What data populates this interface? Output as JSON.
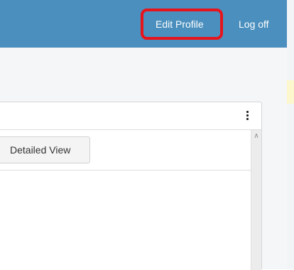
{
  "header": {
    "edit_profile_label": "Edit Profile",
    "log_off_label": "Log off",
    "background_color": "#4a8fbe",
    "highlight_color": "#e8141c"
  },
  "panel": {
    "menu_icon": "kebab-menu-icon",
    "detailed_view_label": "Detailed View",
    "scroll_up_icon": "chevron-up-icon"
  }
}
